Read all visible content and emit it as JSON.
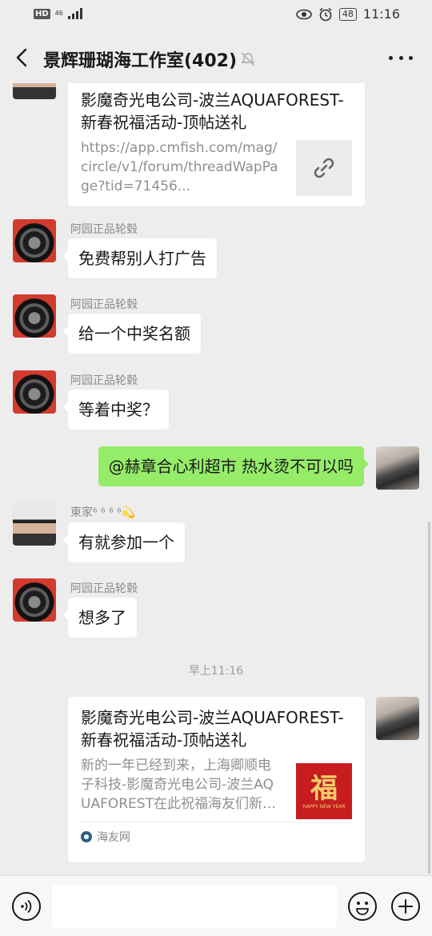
{
  "status_bar": {
    "hd": "HD",
    "network": "46",
    "network_sub": "46",
    "battery": "48",
    "time": "11:16"
  },
  "header": {
    "title": "景辉珊瑚海工作室(402)"
  },
  "messages": [
    {
      "type": "card",
      "title": "影魔奇光电公司-波兰AQUAFOREST-新春祝福活动-顶帖送礼",
      "desc": "https://app.cmfish.com/mag/circle/v1/forum/threadWapPage?tid=71456..."
    },
    {
      "sender": "阿园正品轮毂",
      "text": "免费帮别人打广告"
    },
    {
      "sender": "阿园正品轮毂",
      "text": "给一个中奖名额"
    },
    {
      "sender": "阿园正品轮毂",
      "text": "等着中奖？"
    },
    {
      "text": "@赫章合心利超市  热水烫不可以吗"
    },
    {
      "sender": "東家⁶ ⁶ ⁶ ⁶💫",
      "text": "有就参加一个"
    },
    {
      "sender": "阿园正品轮毂",
      "text": "想多了"
    },
    {
      "timestamp": "早上11:16"
    },
    {
      "type": "card",
      "title": "影魔奇光电公司-波兰AQUAFOREST-新春祝福活动-顶帖送礼",
      "desc": "新的一年已经到来，上海卿顺电子科技-影魔奇光电公司-波兰AQUAFOREST在此祝福海友们新春快乐",
      "thumb_char": "福",
      "thumb_sub": "HAPPY NEW YEAR",
      "source": "海友网"
    }
  ],
  "colors": {
    "background": "#ededed",
    "my_bubble": "#95ec69",
    "other_bubble": "#ffffff"
  },
  "icons": [
    "back-icon",
    "mute-icon",
    "more-icon",
    "link-icon",
    "voice-icon",
    "emoji-icon",
    "plus-icon"
  ]
}
